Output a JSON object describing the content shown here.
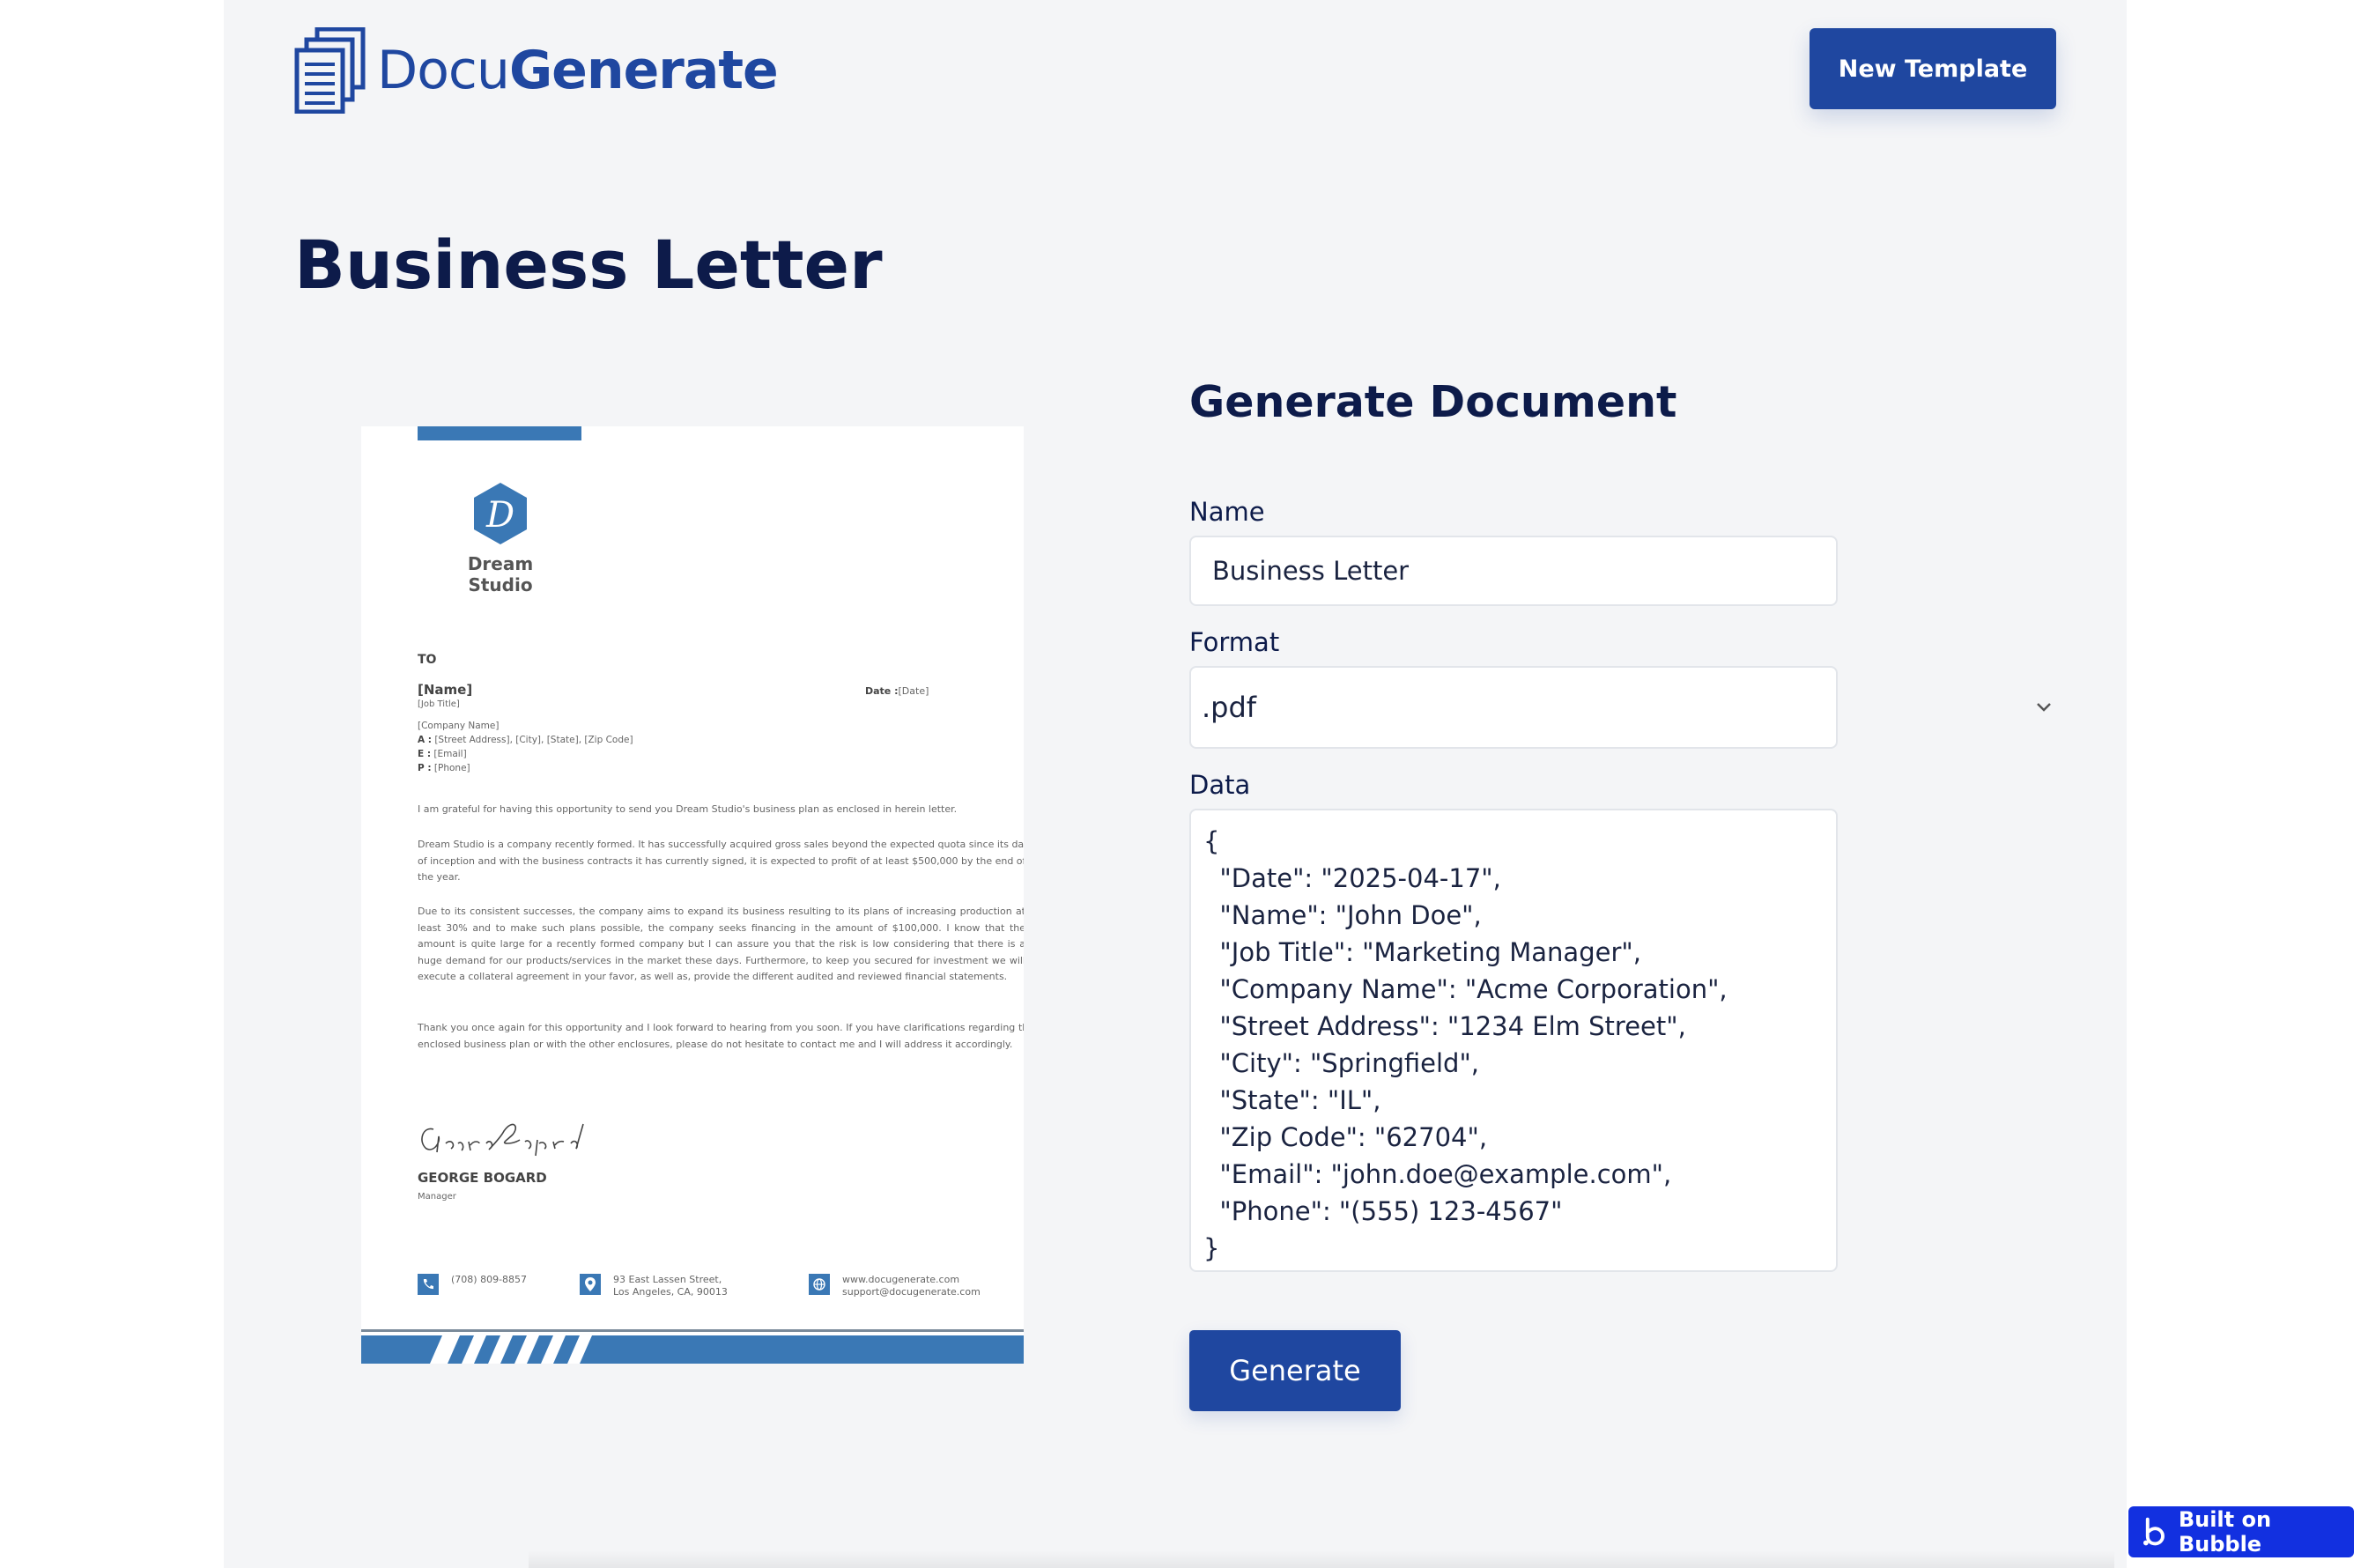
{
  "header": {
    "brand_part1": "Docu",
    "brand_part2": "Generate",
    "new_template_label": "New Template"
  },
  "page_title": "Business Letter",
  "preview": {
    "logo_text": "Dream Studio",
    "to": "TO",
    "name": "[Name]",
    "job_title": "[Job Title]",
    "date_label": "Date :",
    "date_value": "[Date]",
    "company": "[Company Name]",
    "address_label": "A :",
    "address": "[Street Address], [City], [State], [Zip Code]",
    "email_label": "E :",
    "email": "[Email]",
    "phone_label": "P :",
    "phone": "[Phone]",
    "p1": "I am grateful for having this opportunity to send you Dream Studio's business plan as enclosed in herein letter.",
    "p2": "Dream Studio is a company recently formed. It has successfully acquired gross sales beyond the expected quota since its date of inception and with the business contracts it has currently signed, it is expected to profit of at least $500,000 by the end of the year.",
    "p3": "Due to its consistent successes, the company aims to expand its business resulting to its plans of increasing production at least 30% and to make such plans possible, the company seeks financing in the amount of $100,000. I know that the amount is quite large for a recently formed company but I can assure you that the risk is low considering that there is a huge demand for our products/services in the market these days. Furthermore, to keep you secured for investment we will execute a collateral agreement in your favor, as well as, provide the different audited and reviewed financial statements.",
    "p4": "Thank you once again for this opportunity and I look forward to hearing from you soon. If you have clarifications regarding the enclosed business plan or with the other enclosures, please do not hesitate to contact me and I will address it accordingly.",
    "signer_name": "GEORGE BOGARD",
    "signer_role": "Manager",
    "footer_phone": "(708) 809-8857",
    "footer_address1": "93 East Lassen Street,",
    "footer_address2": "Los Angeles, CA, 90013",
    "footer_web": "www.docugenerate.com",
    "footer_email": "support@docugenerate.com"
  },
  "form": {
    "title": "Generate Document",
    "name_label": "Name",
    "name_value": "Business Letter",
    "format_label": "Format",
    "format_value": ".pdf",
    "data_label": "Data",
    "data_value": "{\n  \"Date\": \"2025-04-17\",\n  \"Name\": \"John Doe\",\n  \"Job Title\": \"Marketing Manager\",\n  \"Company Name\": \"Acme Corporation\",\n  \"Street Address\": \"1234 Elm Street\",\n  \"City\": \"Springfield\",\n  \"State\": \"IL\",\n  \"Zip Code\": \"62704\",\n  \"Email\": \"john.doe@example.com\",\n  \"Phone\": \"(555) 123-4567\"\n}",
    "generate_label": "Generate"
  },
  "badge": {
    "label": "Built on Bubble"
  },
  "colors": {
    "brand": "#1f47a0",
    "heading": "#0d1b4a",
    "preview_accent": "#3a78b5",
    "bubble": "#1230e0"
  }
}
